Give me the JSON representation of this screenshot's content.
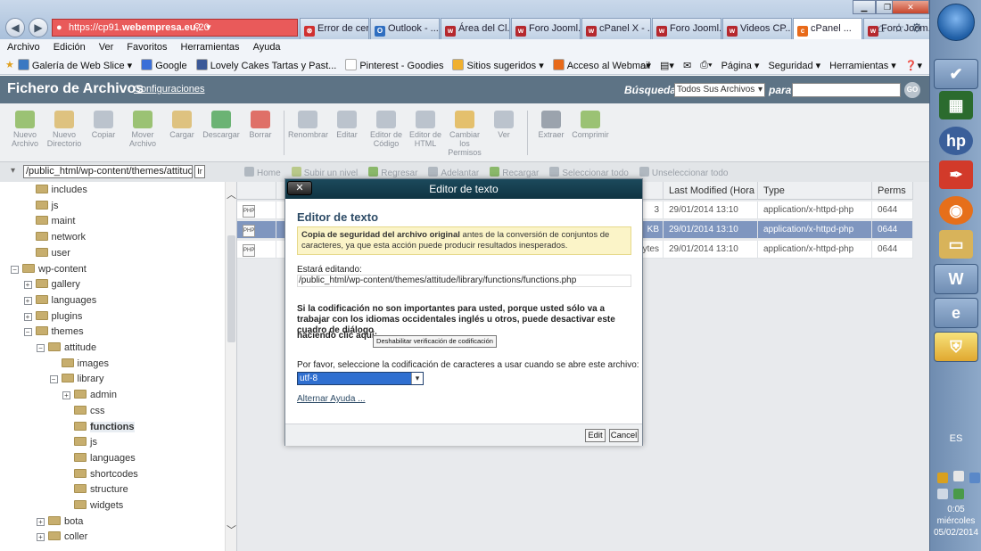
{
  "browser": {
    "address": {
      "prefix": "https://cp91.",
      "domain": "webempresa.eu",
      "suffix": ":20"
    },
    "tabs": [
      {
        "label": "Error de cer...",
        "icon": "error-icon"
      },
      {
        "label": "Outlook - ...",
        "icon": "outlook-icon"
      },
      {
        "label": "Área del Cl...",
        "icon": "webempresa-icon"
      },
      {
        "label": "Foro Jooml...",
        "icon": "webempresa-icon"
      },
      {
        "label": "cPanel X - ...",
        "icon": "webempresa-icon"
      },
      {
        "label": "Foro Jooml...",
        "icon": "webempresa-icon"
      },
      {
        "label": "Videos CP...",
        "icon": "webempresa-icon"
      },
      {
        "label": "cPanel ...",
        "icon": "cpanel-icon",
        "active": true
      },
      {
        "label": "Foro Joom...",
        "icon": "webempresa-icon"
      }
    ],
    "menu": [
      "Archivo",
      "Edición",
      "Ver",
      "Favoritos",
      "Herramientas",
      "Ayuda"
    ],
    "favorites": [
      {
        "label": "Galería de Web Slice ▾",
        "color": "#3a78c2"
      },
      {
        "label": "Google",
        "color": "#3b6fd8"
      },
      {
        "label": "Lovely Cakes Tartas y Past...",
        "color": "#3b5998"
      },
      {
        "label": "Pinterest - Goodies",
        "color": "#ffffff"
      },
      {
        "label": "Sitios sugeridos ▾",
        "color": "#f0b030"
      },
      {
        "label": "Acceso al Webmail",
        "color": "#e86a1a"
      }
    ],
    "commands": [
      "Página ▾",
      "Seguridad ▾",
      "Herramientas ▾"
    ]
  },
  "fm": {
    "title": "Fichero de Archivos",
    "config_link": "Configuraciones",
    "search_label": "Búsqueda",
    "search_select": "Todos Sus Archivos",
    "search_para": "para",
    "search_go": "GO",
    "toolbar": [
      {
        "label": "Nuevo Archivo",
        "color": "#7fb34a"
      },
      {
        "label": "Nuevo Directorio",
        "color": "#d8b35a"
      },
      {
        "label": "Copiar",
        "color": "#a9b4c0"
      },
      {
        "label": "Mover Archivo",
        "color": "#7fb34a"
      },
      {
        "label": "Cargar",
        "color": "#d8b35a"
      },
      {
        "label": "Descargar",
        "color": "#3f9f4a"
      },
      {
        "label": "Borrar",
        "color": "#d9453a",
        "sep_after": true
      },
      {
        "label": "Renombrar",
        "color": "#a9b4c0"
      },
      {
        "label": "Editar",
        "color": "#a9b4c0"
      },
      {
        "label": "Editor de Código",
        "color": "#a9b4c0"
      },
      {
        "label": "Editor de HTML",
        "color": "#a9b4c0"
      },
      {
        "label": "Cambiar los Permisos",
        "color": "#e0b040"
      },
      {
        "label": "Ver",
        "color": "#a9b4c0",
        "sep_after": true
      },
      {
        "label": "Extraer",
        "color": "#7f8a95"
      },
      {
        "label": "Comprimir",
        "color": "#7fb34a"
      }
    ],
    "path": "/public_html/wp-content/themes/attitude",
    "path_go": "Ir",
    "nav": [
      {
        "label": "Home",
        "color": "#b0b8c0"
      },
      {
        "label": "Subir un nivel",
        "color": "#b9c98a"
      },
      {
        "label": "Regresar",
        "color": "#8ab86a"
      },
      {
        "label": "Adelantar",
        "color": "#b0b8c0"
      },
      {
        "label": "Recargar",
        "color": "#8ab86a"
      },
      {
        "label": "Seleccionar todo",
        "color": "#b0b8c0"
      },
      {
        "label": "Unseleccionar todo",
        "color": "#b0b8c0"
      }
    ],
    "tree": [
      {
        "label": "includes",
        "level": 2,
        "expander": ""
      },
      {
        "label": "js",
        "level": 2,
        "expander": ""
      },
      {
        "label": "maint",
        "level": 2,
        "expander": ""
      },
      {
        "label": "network",
        "level": 2,
        "expander": ""
      },
      {
        "label": "user",
        "level": 2,
        "expander": ""
      },
      {
        "label": "wp-content",
        "level": 1,
        "expander": "−"
      },
      {
        "label": "gallery",
        "level": 2,
        "expander": "+"
      },
      {
        "label": "languages",
        "level": 2,
        "expander": "+"
      },
      {
        "label": "plugins",
        "level": 2,
        "expander": "+"
      },
      {
        "label": "themes",
        "level": 2,
        "expander": "−"
      },
      {
        "label": "attitude",
        "level": 3,
        "expander": "−"
      },
      {
        "label": "images",
        "level": 4,
        "expander": ""
      },
      {
        "label": "library",
        "level": 4,
        "expander": "−"
      },
      {
        "label": "admin",
        "level": 5,
        "expander": "+"
      },
      {
        "label": "css",
        "level": 5,
        "expander": ""
      },
      {
        "label": "functions",
        "level": 5,
        "expander": "",
        "bold": true
      },
      {
        "label": "js",
        "level": 5,
        "expander": ""
      },
      {
        "label": "languages",
        "level": 5,
        "expander": ""
      },
      {
        "label": "shortcodes",
        "level": 5,
        "expander": ""
      },
      {
        "label": "structure",
        "level": 5,
        "expander": ""
      },
      {
        "label": "widgets",
        "level": 5,
        "expander": ""
      },
      {
        "label": "bota",
        "level": 3,
        "expander": "+"
      },
      {
        "label": "coller",
        "level": 3,
        "expander": "+"
      }
    ],
    "columns": [
      "",
      "",
      "Last Modified (Hora está",
      "Type",
      "Perms"
    ],
    "rows": [
      {
        "icon": "PHP",
        "size": "3",
        "modified": "29/01/2014 13:10",
        "type": "application/x-httpd-php",
        "perms": "0644",
        "selected": false
      },
      {
        "icon": "PHP",
        "size": "KB",
        "modified": "29/01/2014 13:10",
        "type": "application/x-httpd-php",
        "perms": "0644",
        "selected": true
      },
      {
        "icon": "PHP",
        "size": "ytes",
        "modified": "29/01/2014 13:10",
        "type": "application/x-httpd-php",
        "perms": "0644",
        "selected": false
      }
    ]
  },
  "dialog": {
    "title": "Editor de texto",
    "close": "✕",
    "heading": "Editor de texto",
    "warning_bold": "Copia de seguridad del archivo original",
    "warning_rest": " antes de la conversión de conjuntos de caracteres, ya que esta acción puede producir resultados inesperados.",
    "editing_label": "Estará editando:",
    "editing_path": "/public_html/wp-content/themes/attitude/library/functions/functions.php",
    "note": "Si la codificación no son importantes para usted, porque usted sólo va a trabajar con los idiomas occidentales inglés u otros, puede desactivar este cuadro de diálogo",
    "click_here": "haciendo clic aquí:",
    "disable_button": "Deshabilitar verificación de codificación",
    "select_label": "Por favor, seleccione la codificación de caracteres a usar cuando se abre este archivo:",
    "encoding": "utf-8",
    "help_link": "Alternar Ayuda ...",
    "edit_button": "Edit",
    "cancel_button": "Cancel"
  },
  "taskbar": {
    "lang": "ES",
    "time": "0:05",
    "day": "miércoles",
    "date": "05/02/2014"
  }
}
